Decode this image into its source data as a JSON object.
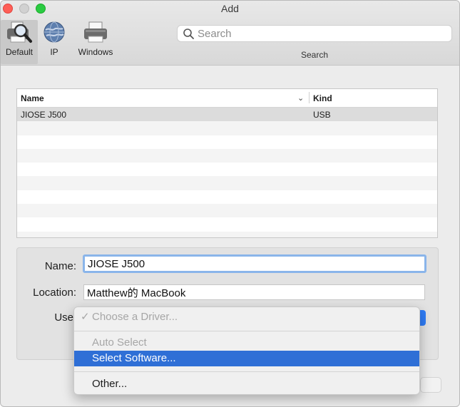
{
  "window": {
    "title": "Add"
  },
  "toolbar": {
    "tools": [
      {
        "label": "Default",
        "icon": "printer-magnifier-icon"
      },
      {
        "label": "IP",
        "icon": "globe-icon"
      },
      {
        "label": "Windows",
        "icon": "printer-icon"
      }
    ],
    "search_placeholder": "Search",
    "search_label": "Search"
  },
  "table": {
    "columns": {
      "name": "Name",
      "kind": "Kind"
    },
    "rows": [
      {
        "name": "JIOSE J500",
        "kind": "USB"
      }
    ]
  },
  "form": {
    "name_label": "Name:",
    "name_value": "JIOSE J500",
    "location_label": "Location:",
    "location_value": "Matthew的 MacBook",
    "use_label": "Use"
  },
  "menu": {
    "choose_driver": "Choose a Driver...",
    "auto_select": "Auto Select",
    "select_software": "Select Software...",
    "other": "Other..."
  },
  "colors": {
    "accent": "#2f6fd6",
    "focus_ring": "#8ab5ea"
  }
}
